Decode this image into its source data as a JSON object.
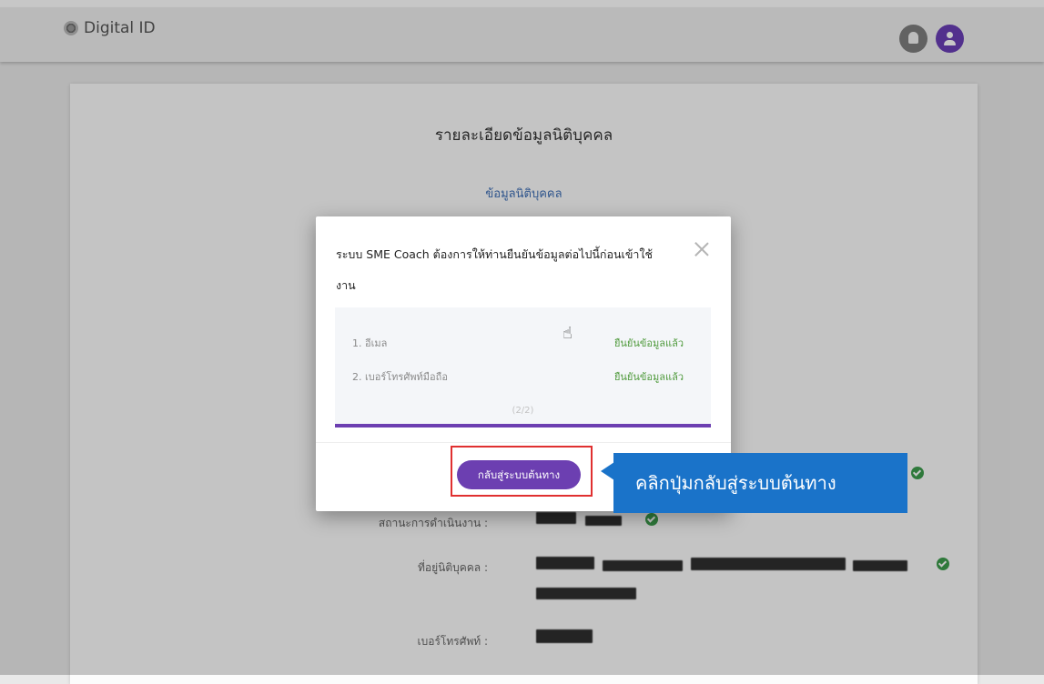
{
  "header": {
    "brand": "Digital ID",
    "brand_icon": "fingerprint-icon",
    "notification_icon": "bell-icon",
    "account_icon": "user-icon"
  },
  "card": {
    "title": "รายละเอียดข้อมูลนิติบุคคล",
    "subtitle": "ข้อมูลนิติบุคคล",
    "rows": [
      {
        "label": "สถานะการดำเนินงาน :"
      },
      {
        "label": "ที่อยู่นิติบุคคล :"
      },
      {
        "label": "เบอร์โทรศัพท์ :"
      }
    ]
  },
  "modal": {
    "message_line1": "ระบบ SME Coach ต้องการให้ท่านยืนยันข้อมูลต่อไปนี้ก่อนเข้าใช้",
    "message_line2": "งาน",
    "items": [
      {
        "label": "1. อีเมล",
        "status": "ยืนยันข้อมูลแล้ว"
      },
      {
        "label": "2. เบอร์โทรศัพท์มือถือ",
        "status": "ยืนยันข้อมูลแล้ว"
      }
    ],
    "progress_text": "(2/2)",
    "progress_fraction": 1.0,
    "back_button": "กลับสู่ระบบต้นทาง"
  },
  "callout": {
    "text": "คลิกปุ่มกลับสู่ระบบต้นทาง"
  },
  "colors": {
    "accent": "#6c3fb1",
    "success": "#4f9a3c",
    "callout": "#1a73c9",
    "highlight": "#e03030"
  }
}
